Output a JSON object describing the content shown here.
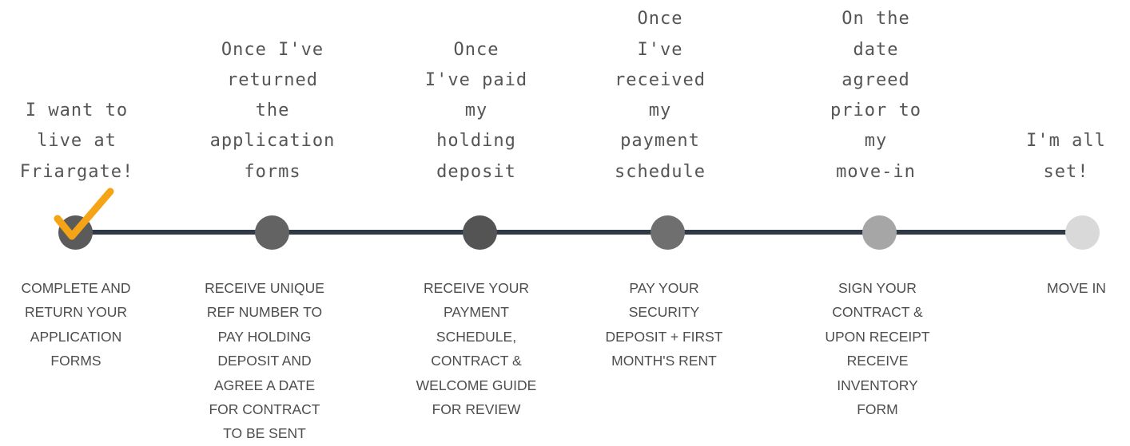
{
  "steps": [
    {
      "top_label": "I want to\nlive at\nFriargate!",
      "bottom_label": "COMPLETE AND\nRETURN YOUR\nAPPLICATION\nFORMS",
      "node_color": "#5b5b5b",
      "completed": true
    },
    {
      "top_label": "Once I've\nreturned\nthe\napplication\nforms",
      "bottom_label": "RECEIVE UNIQUE\nREF NUMBER TO\nPAY HOLDING\nDEPOSIT AND\nAGREE A DATE\nFOR CONTRACT\nTO BE SENT",
      "node_color": "#636363",
      "completed": false
    },
    {
      "top_label": "Once\nI've paid\nmy\nholding\ndeposit",
      "bottom_label": "RECEIVE YOUR\nPAYMENT\nSCHEDULE,\nCONTRACT &\nWELCOME GUIDE\nFOR REVIEW",
      "node_color": "#545454",
      "completed": false
    },
    {
      "top_label": "Once\nI've\nreceived\nmy\npayment\nschedule",
      "bottom_label": "PAY YOUR\nSECURITY\nDEPOSIT + FIRST\nMONTH'S RENT",
      "node_color": "#6f6f6f",
      "completed": false
    },
    {
      "top_label": "On the\ndate\nagreed\nprior to\nmy\nmove-in",
      "bottom_label": "SIGN YOUR\nCONTRACT &\nUPON RECEIPT\nRECEIVE\nINVENTORY\nFORM",
      "node_color": "#a6a6a6",
      "completed": false
    },
    {
      "top_label": "I'm all\nset!",
      "bottom_label": "MOVE IN",
      "node_color": "#d9d9d9",
      "completed": false
    }
  ],
  "colors": {
    "line": "#2f3a46",
    "checkmark": "#f5a416"
  }
}
